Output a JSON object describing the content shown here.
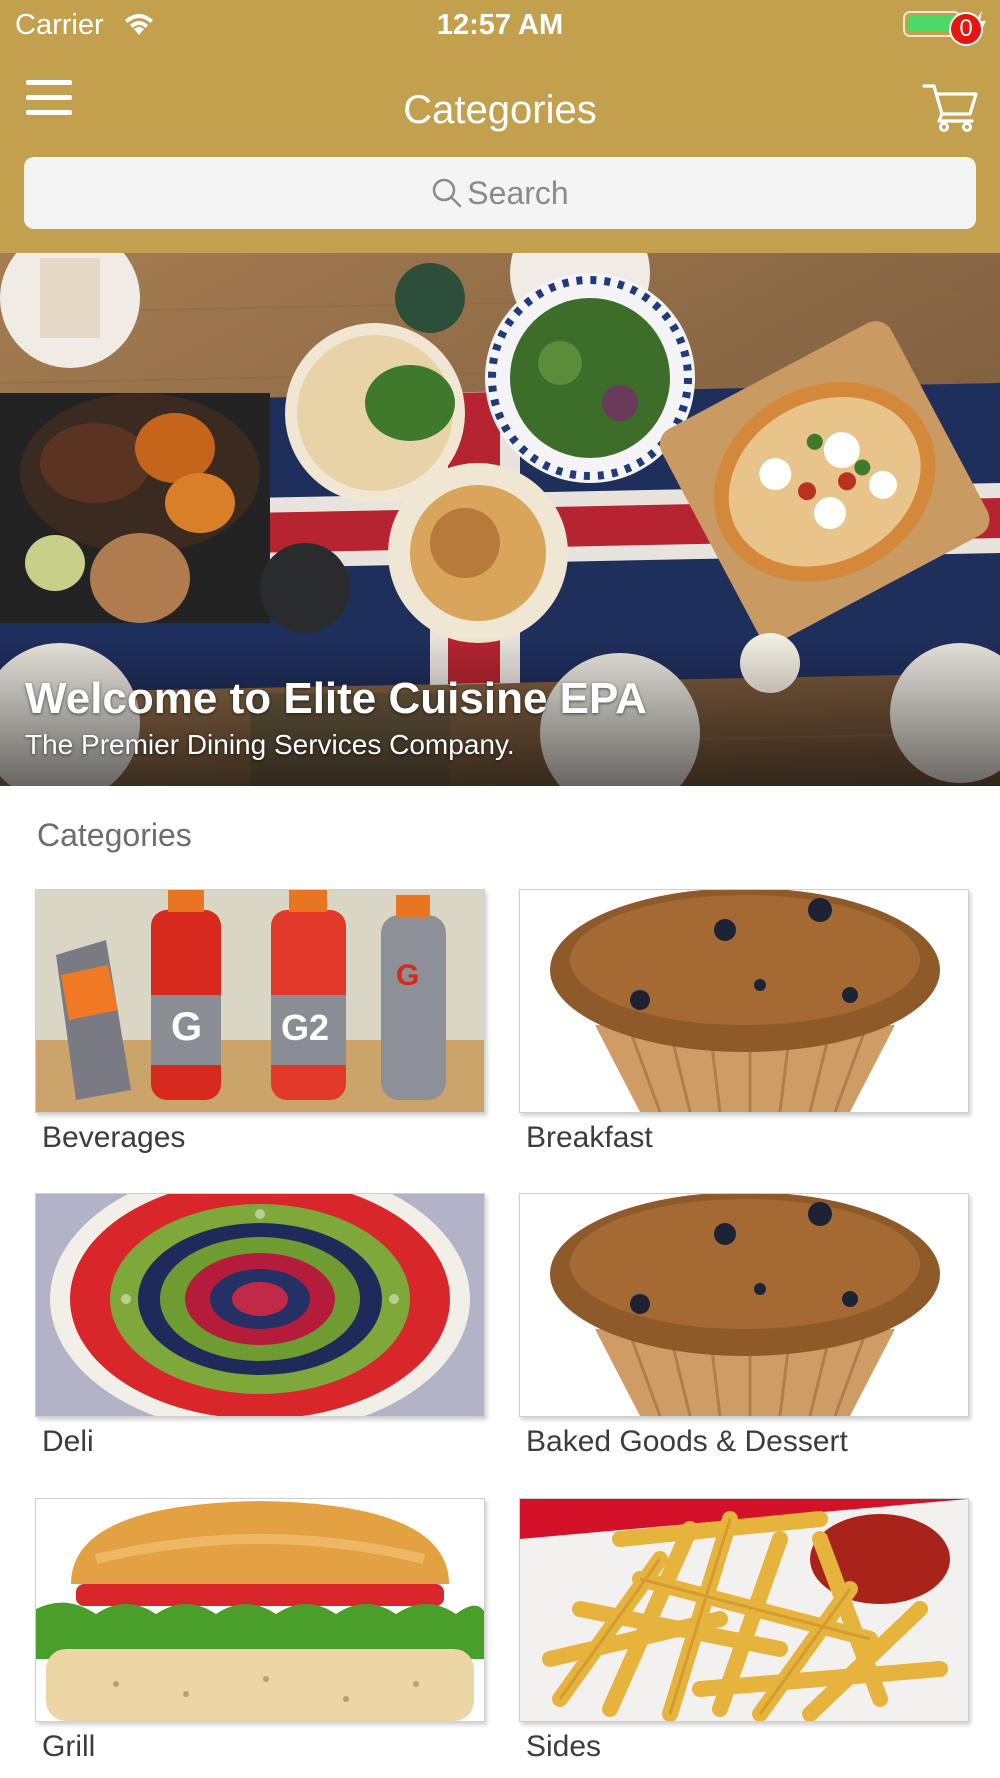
{
  "status_bar": {
    "carrier": "Carrier",
    "time": "12:57 AM",
    "battery_color": "#4cd964"
  },
  "nav": {
    "title": "Categories",
    "menu_icon": "hamburger-menu-icon",
    "cart_icon": "shopping-cart-icon",
    "cart_count": "0"
  },
  "search": {
    "placeholder": "Search",
    "icon": "search-icon"
  },
  "hero": {
    "title": "Welcome to Elite Cuisine EPA",
    "subtitle": "The Premier Dining Services Company."
  },
  "categories": {
    "heading": "Categories",
    "items": [
      {
        "label": "Beverages"
      },
      {
        "label": "Breakfast"
      },
      {
        "label": "Deli"
      },
      {
        "label": "Baked Goods & Dessert"
      },
      {
        "label": "Grill"
      },
      {
        "label": "Sides"
      }
    ]
  },
  "theme": {
    "header_color": "#c2a04e",
    "badge_color": "#e8140f"
  }
}
